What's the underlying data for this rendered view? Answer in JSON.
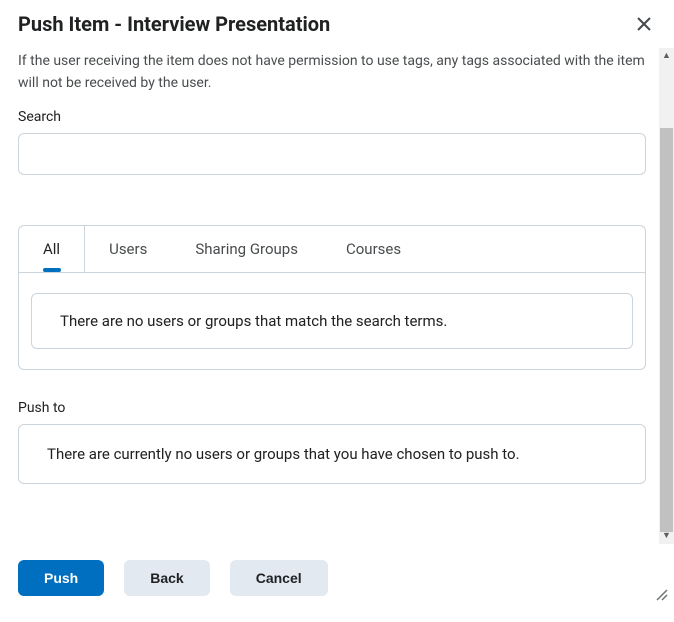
{
  "header": {
    "title": "Push Item - Interview Presentation"
  },
  "body": {
    "info_text": "If the user receiving the item does not have permission to use tags, any tags associated with the item will not be received by the user.",
    "search_label": "Search",
    "search_value": "",
    "tabs": {
      "all": "All",
      "users": "Users",
      "sharing_groups": "Sharing Groups",
      "courses": "Courses"
    },
    "results": {
      "empty_message": "There are no users or groups that match the search terms."
    },
    "push_to": {
      "label": "Push to",
      "empty_message": "There are currently no users or groups that you have chosen to push to."
    }
  },
  "footer": {
    "push": "Push",
    "back": "Back",
    "cancel": "Cancel"
  }
}
